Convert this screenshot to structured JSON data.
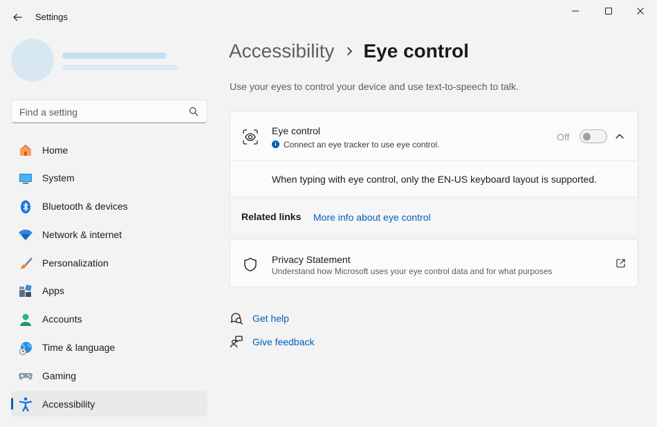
{
  "window": {
    "title": "Settings"
  },
  "search": {
    "placeholder": "Find a setting"
  },
  "sidebar": {
    "items": [
      {
        "label": "Home",
        "icon": "home-icon"
      },
      {
        "label": "System",
        "icon": "system-icon"
      },
      {
        "label": "Bluetooth & devices",
        "icon": "bluetooth-icon"
      },
      {
        "label": "Network & internet",
        "icon": "wifi-icon"
      },
      {
        "label": "Personalization",
        "icon": "brush-icon"
      },
      {
        "label": "Apps",
        "icon": "apps-icon"
      },
      {
        "label": "Accounts",
        "icon": "person-icon"
      },
      {
        "label": "Time & language",
        "icon": "globe-clock-icon"
      },
      {
        "label": "Gaming",
        "icon": "gamepad-icon"
      },
      {
        "label": "Accessibility",
        "icon": "accessibility-icon",
        "active": true
      }
    ]
  },
  "breadcrumb": {
    "parent": "Accessibility",
    "current": "Eye control"
  },
  "page": {
    "description": "Use your eyes to control your device and use text-to-speech to talk."
  },
  "eye_control": {
    "title": "Eye control",
    "subtitle": "Connect an eye tracker to use eye control.",
    "toggle_state": "Off",
    "toggle_on": false,
    "note": "When typing with eye control, only the EN-US keyboard layout is supported.",
    "related_label": "Related links",
    "related_link": "More info about eye control"
  },
  "privacy": {
    "title": "Privacy Statement",
    "subtitle": "Understand how Microsoft uses your eye control data and for what purposes"
  },
  "help": {
    "get_help": "Get help",
    "give_feedback": "Give feedback"
  },
  "colors": {
    "accent": "#005fb8",
    "background": "#f3f3f3",
    "card": "#fbfbfb"
  }
}
